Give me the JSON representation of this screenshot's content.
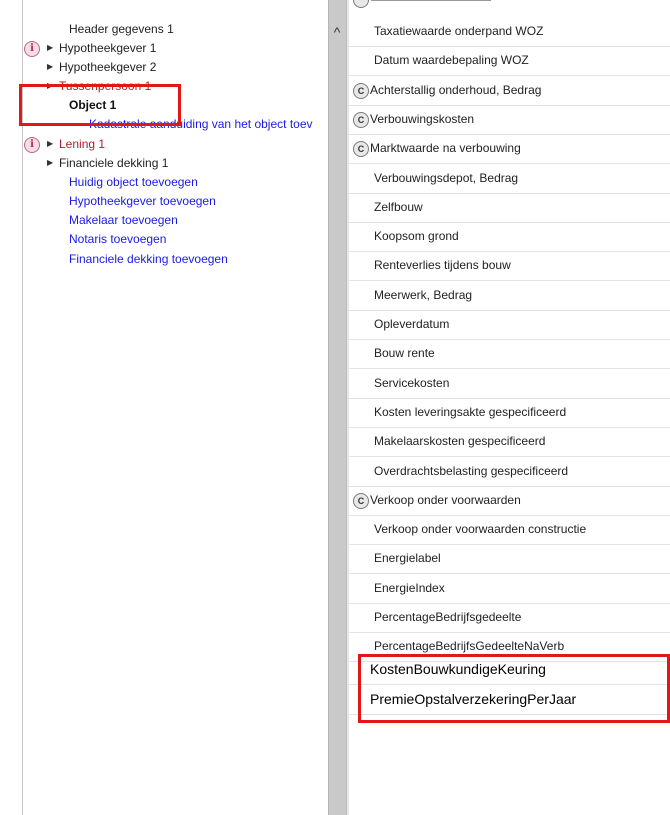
{
  "tree": {
    "items": [
      {
        "label": "Header gegevens 1",
        "info": false,
        "arrow": false,
        "style": "normal"
      },
      {
        "label": "Hypotheekgever 1",
        "info": true,
        "arrow": true,
        "style": "normal"
      },
      {
        "label": "Hypotheekgever 2",
        "info": false,
        "arrow": true,
        "style": "normal"
      },
      {
        "label": "Tussenpersoon 1",
        "info": false,
        "arrow": true,
        "style": "obscured"
      },
      {
        "label": "Object 1",
        "info": false,
        "arrow": false,
        "style": "bold"
      },
      {
        "label": "Kadastrale aanduiding van het object toev",
        "info": false,
        "arrow": false,
        "style": "link-indent"
      },
      {
        "label": "Lening 1",
        "info": true,
        "arrow": true,
        "style": "red"
      },
      {
        "label": "Financiele dekking 1",
        "info": false,
        "arrow": true,
        "style": "normal"
      },
      {
        "label": "Huidig object toevoegen",
        "info": false,
        "arrow": false,
        "style": "link"
      },
      {
        "label": "Hypotheekgever toevoegen",
        "info": false,
        "arrow": false,
        "style": "link"
      },
      {
        "label": "Makelaar toevoegen",
        "info": false,
        "arrow": false,
        "style": "link"
      },
      {
        "label": "Notaris toevoegen",
        "info": false,
        "arrow": false,
        "style": "link"
      },
      {
        "label": "Financiele dekking toevoegen",
        "info": false,
        "arrow": false,
        "style": "link"
      }
    ],
    "info_glyph": "i",
    "arrow_glyph": "▶",
    "scroll_up_glyph": "^"
  },
  "fields": {
    "items": [
      {
        "label": "Taxatiewaarde onderpand WOZ",
        "calc": false
      },
      {
        "label": "Datum waardebepaling WOZ",
        "calc": false
      },
      {
        "label": "Achterstallig onderhoud, Bedrag",
        "calc": true
      },
      {
        "label": "Verbouwingskosten",
        "calc": true
      },
      {
        "label": "Marktwaarde na verbouwing",
        "calc": true
      },
      {
        "label": "Verbouwingsdepot, Bedrag",
        "calc": false
      },
      {
        "label": "Zelfbouw",
        "calc": false
      },
      {
        "label": "Koopsom grond",
        "calc": false
      },
      {
        "label": "Renteverlies tijdens bouw",
        "calc": false
      },
      {
        "label": "Meerwerk, Bedrag",
        "calc": false
      },
      {
        "label": "Opleverdatum",
        "calc": false
      },
      {
        "label": "Bouw rente",
        "calc": false
      },
      {
        "label": "Servicekosten",
        "calc": false
      },
      {
        "label": "Kosten leveringsakte gespecificeerd",
        "calc": false
      },
      {
        "label": "Makelaarskosten gespecificeerd",
        "calc": false
      },
      {
        "label": "Overdrachtsbelasting gespecificeerd",
        "calc": false
      },
      {
        "label": "Verkoop onder voorwaarden",
        "calc": true
      },
      {
        "label": "Verkoop onder voorwaarden constructie",
        "calc": false
      },
      {
        "label": "Energielabel",
        "calc": false
      },
      {
        "label": "EnergieIndex",
        "calc": false
      },
      {
        "label": "PercentageBedrijfsgedeelte",
        "calc": false
      },
      {
        "label": "PercentageBedrijfsGedeelteNaVerb",
        "calc": false
      }
    ],
    "new_items": [
      {
        "label": "KostenBouwkundigeKeuring"
      },
      {
        "label": "PremieOpstalverzekeringPerJaar"
      }
    ],
    "calc_glyph": "C"
  },
  "colors": {
    "link": "#1a1ae6",
    "error": "#b01c2e",
    "highlight": "#e01818",
    "info_icon": "#b22b5c"
  }
}
